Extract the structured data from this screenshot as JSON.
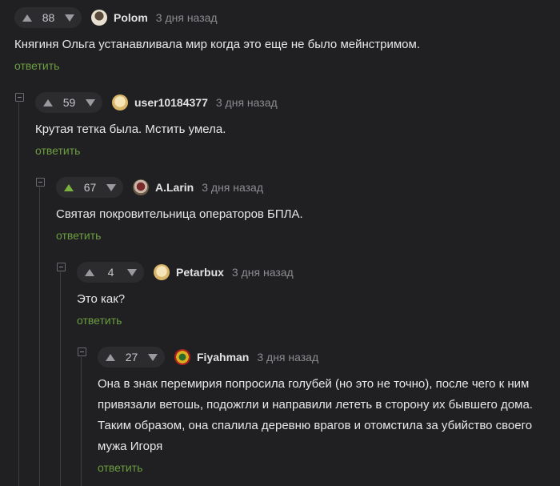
{
  "colors": {
    "background": "#202022",
    "reply": "#6b9d40",
    "upvote_active": "#7bb13e",
    "text": "#e8e8e8",
    "muted": "#8c8c90"
  },
  "comments": [
    {
      "score": "88",
      "author": "Polom",
      "time": "3 дня назад",
      "text": "Княгиня Ольга устанавливала мир когда это еще не было мейнстримом.",
      "reply": "ответить",
      "upvoted": false
    },
    {
      "score": "59",
      "author": "user10184377",
      "time": "3 дня назад",
      "text": "Крутая тетка была. Мстить умела.",
      "reply": "ответить",
      "upvoted": false
    },
    {
      "score": "67",
      "author": "A.Larin",
      "time": "3 дня назад",
      "text": "Святая покровительница операторов БПЛА.",
      "reply": "ответить",
      "upvoted": true
    },
    {
      "score": "4",
      "author": "Petarbux",
      "time": "3 дня назад",
      "text": "Это как?",
      "reply": "ответить",
      "upvoted": false
    },
    {
      "score": "27",
      "author": "Fiyahman",
      "time": "3 дня назад",
      "text": "Она в знак перемирия попросила голубей (но это не точно), после чего к ним привязали ветошь, подожгли и направили лететь в сторону их бывшего дома. Таким образом, она спалила деревню врагов и отомстила за убийство своего мужа Игоря",
      "reply": "ответить",
      "upvoted": false
    }
  ]
}
